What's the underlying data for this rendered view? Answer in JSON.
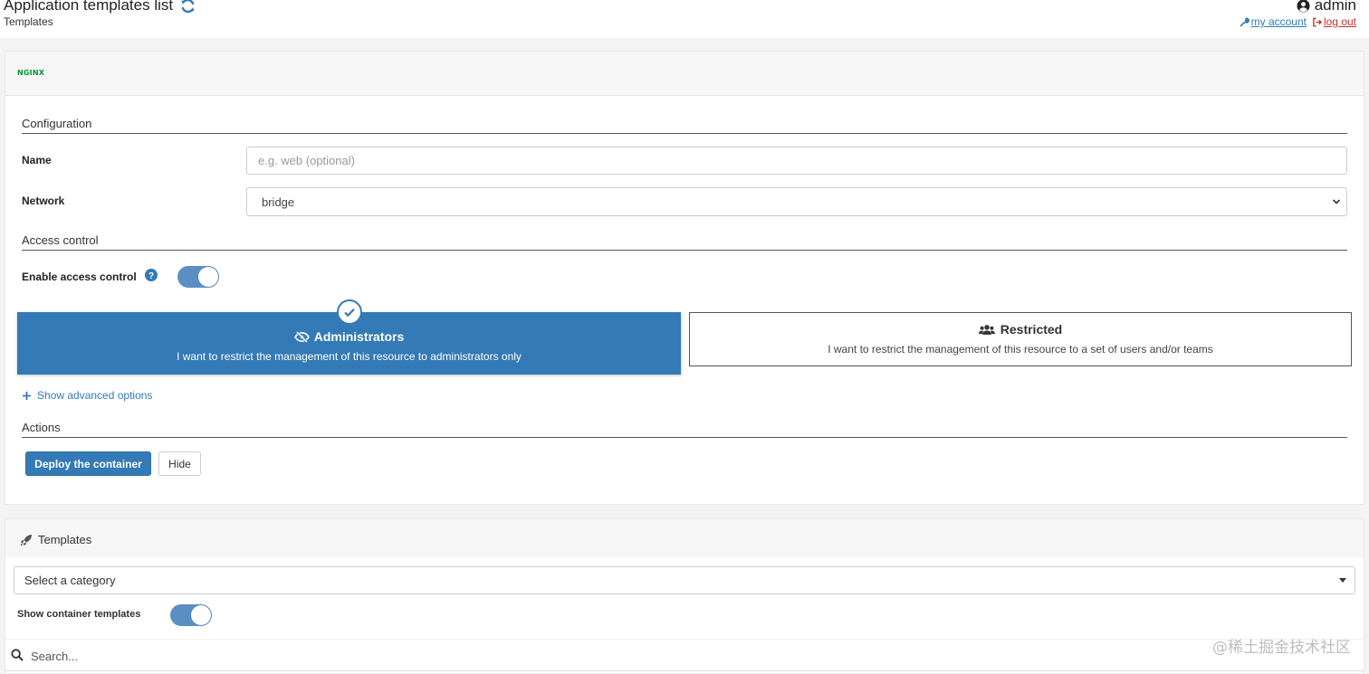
{
  "header": {
    "title": "Application templates list",
    "breadcrumb": "Templates",
    "username": "admin",
    "my_account": "my account",
    "log_out": "log out"
  },
  "template_panel": {
    "logo_text": "NGINX",
    "configuration_title": "Configuration",
    "name_label": "Name",
    "name_placeholder": "e.g. web (optional)",
    "network_label": "Network",
    "network_value": "bridge",
    "access_control_title": "Access control",
    "enable_access_label": "Enable access control",
    "enable_access_on": true,
    "admin_option": {
      "title": "Administrators",
      "description": "I want to restrict the management of this resource to administrators only",
      "selected": true
    },
    "restricted_option": {
      "title": "Restricted",
      "description": "I want to restrict the management of this resource to a set of users and/or teams",
      "selected": false
    },
    "advanced_link": "Show advanced options",
    "actions_title": "Actions",
    "deploy_button": "Deploy the container",
    "hide_button": "Hide"
  },
  "templates_panel": {
    "title": "Templates",
    "category_placeholder": "Select a category",
    "show_container_label": "Show container templates",
    "show_container_on": true,
    "search_placeholder": "Search..."
  },
  "watermark": "@稀土掘金技术社区",
  "colors": {
    "primary": "#337ab7",
    "toggle": "#5b8fc4",
    "danger": "#c9302c",
    "nginx": "#009639"
  }
}
